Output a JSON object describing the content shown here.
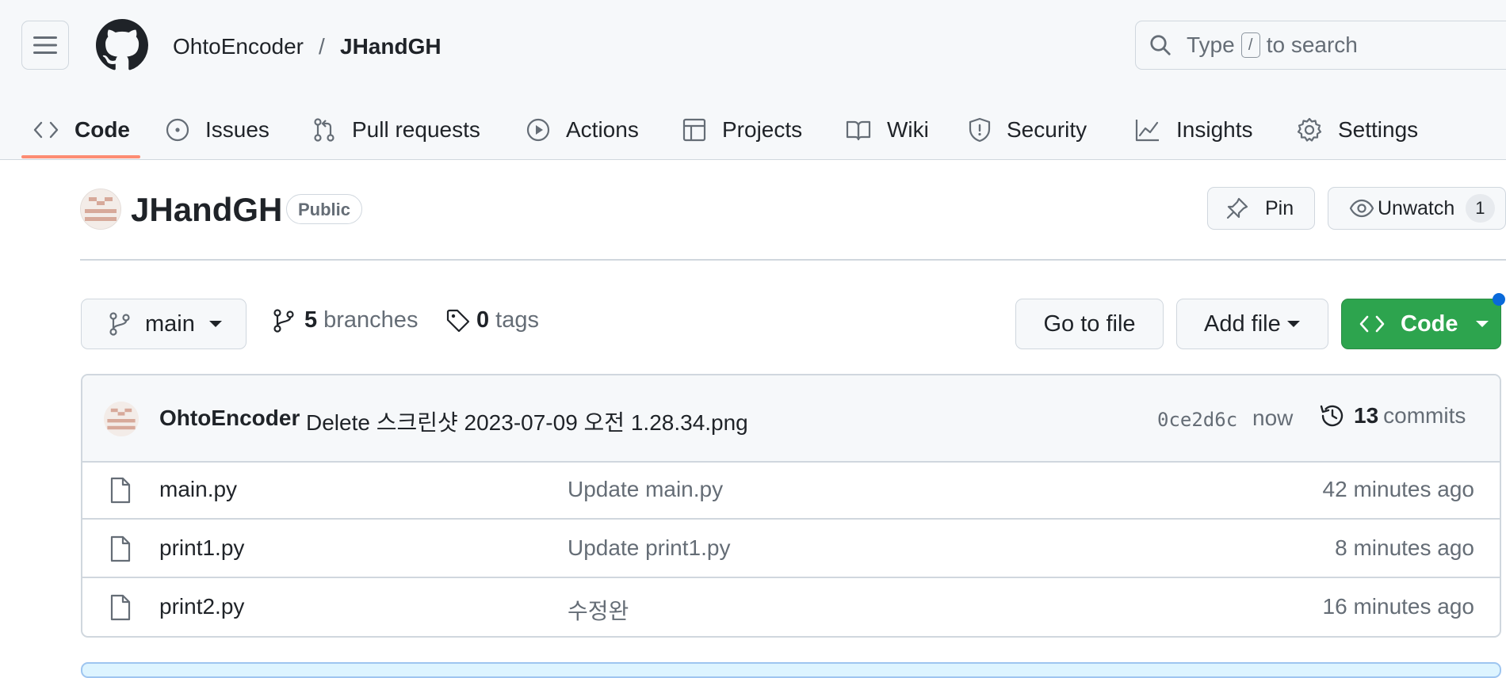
{
  "header": {
    "owner": "OhtoEncoder",
    "separator": "/",
    "repo": "JHandGH",
    "search": {
      "prefix": "Type",
      "key": "/",
      "suffix": "to search"
    }
  },
  "tabs": [
    {
      "label": "Code",
      "icon": "code-icon",
      "active": true
    },
    {
      "label": "Issues",
      "icon": "issue-opened-icon"
    },
    {
      "label": "Pull requests",
      "icon": "git-pull-request-icon"
    },
    {
      "label": "Actions",
      "icon": "play-icon"
    },
    {
      "label": "Projects",
      "icon": "table-icon"
    },
    {
      "label": "Wiki",
      "icon": "book-icon"
    },
    {
      "label": "Security",
      "icon": "shield-icon"
    },
    {
      "label": "Insights",
      "icon": "graph-icon"
    },
    {
      "label": "Settings",
      "icon": "gear-icon"
    }
  ],
  "repo_header": {
    "name": "JHandGH",
    "visibility": "Public",
    "pin_label": "Pin",
    "unwatch_label": "Unwatch",
    "watch_count": "1"
  },
  "toolbar": {
    "branch": "main",
    "branches_count": "5",
    "branches_label": "branches",
    "tags_count": "0",
    "tags_label": "tags",
    "go_to_file": "Go to file",
    "add_file": "Add file",
    "code": "Code"
  },
  "latest_commit": {
    "author": "OhtoEncoder",
    "message": "Delete 스크린샷 2023-07-09 오전 1.28.34.png",
    "sha": "0ce2d6c",
    "time": "now",
    "commit_count": "13",
    "commit_label": "commits"
  },
  "files": [
    {
      "name": "main.py",
      "message": "Update main.py",
      "time": "42 minutes ago"
    },
    {
      "name": "print1.py",
      "message": "Update print1.py",
      "time": "8 minutes ago"
    },
    {
      "name": "print2.py",
      "message": "수정완",
      "time": "16 minutes ago"
    }
  ],
  "colors": {
    "accent_underline": "#fd8c73",
    "code_button": "#2da44e",
    "link_blue": "#0969da"
  }
}
